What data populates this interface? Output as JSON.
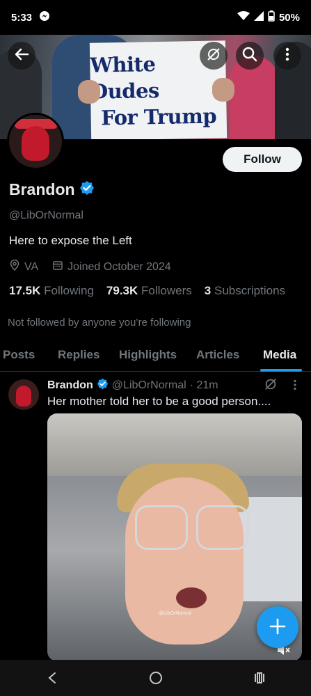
{
  "status_bar": {
    "time": "5:33",
    "battery": "50%"
  },
  "banner": {
    "sign_line1": "White Dudes",
    "sign_line2": "For Trump"
  },
  "profile": {
    "display_name": "Brandon",
    "handle": "@LibOrNormal",
    "bio": "Here to expose the Left",
    "location": "VA",
    "joined": "Joined October 2024",
    "following_count": "17.5K",
    "following_label": "Following",
    "followers_count": "79.3K",
    "followers_label": "Followers",
    "subscriptions_count": "3",
    "subscriptions_label": "Subscriptions",
    "not_followed": "Not followed by anyone you’re following",
    "follow_label": "Follow"
  },
  "tabs": [
    {
      "label": "Posts"
    },
    {
      "label": "Replies"
    },
    {
      "label": "Highlights"
    },
    {
      "label": "Articles"
    },
    {
      "label": "Media",
      "active": true
    }
  ],
  "post": {
    "author": "Brandon",
    "handle": "@LibOrNormal",
    "time": "· 21m",
    "text": "Her mother told her to be a good person....",
    "watermark": "@LibOrNormal"
  },
  "colors": {
    "accent": "#1d9bf0",
    "verified": "#1d9bf0",
    "muted_text": "#71767b"
  },
  "icons": [
    "back-arrow-icon",
    "grok-icon",
    "search-icon",
    "more-vertical-icon",
    "verified-badge-icon",
    "location-icon",
    "calendar-icon",
    "compose-plus-icon",
    "volume-mute-icon",
    "nav-back-icon",
    "nav-home-icon",
    "nav-recents-icon"
  ]
}
